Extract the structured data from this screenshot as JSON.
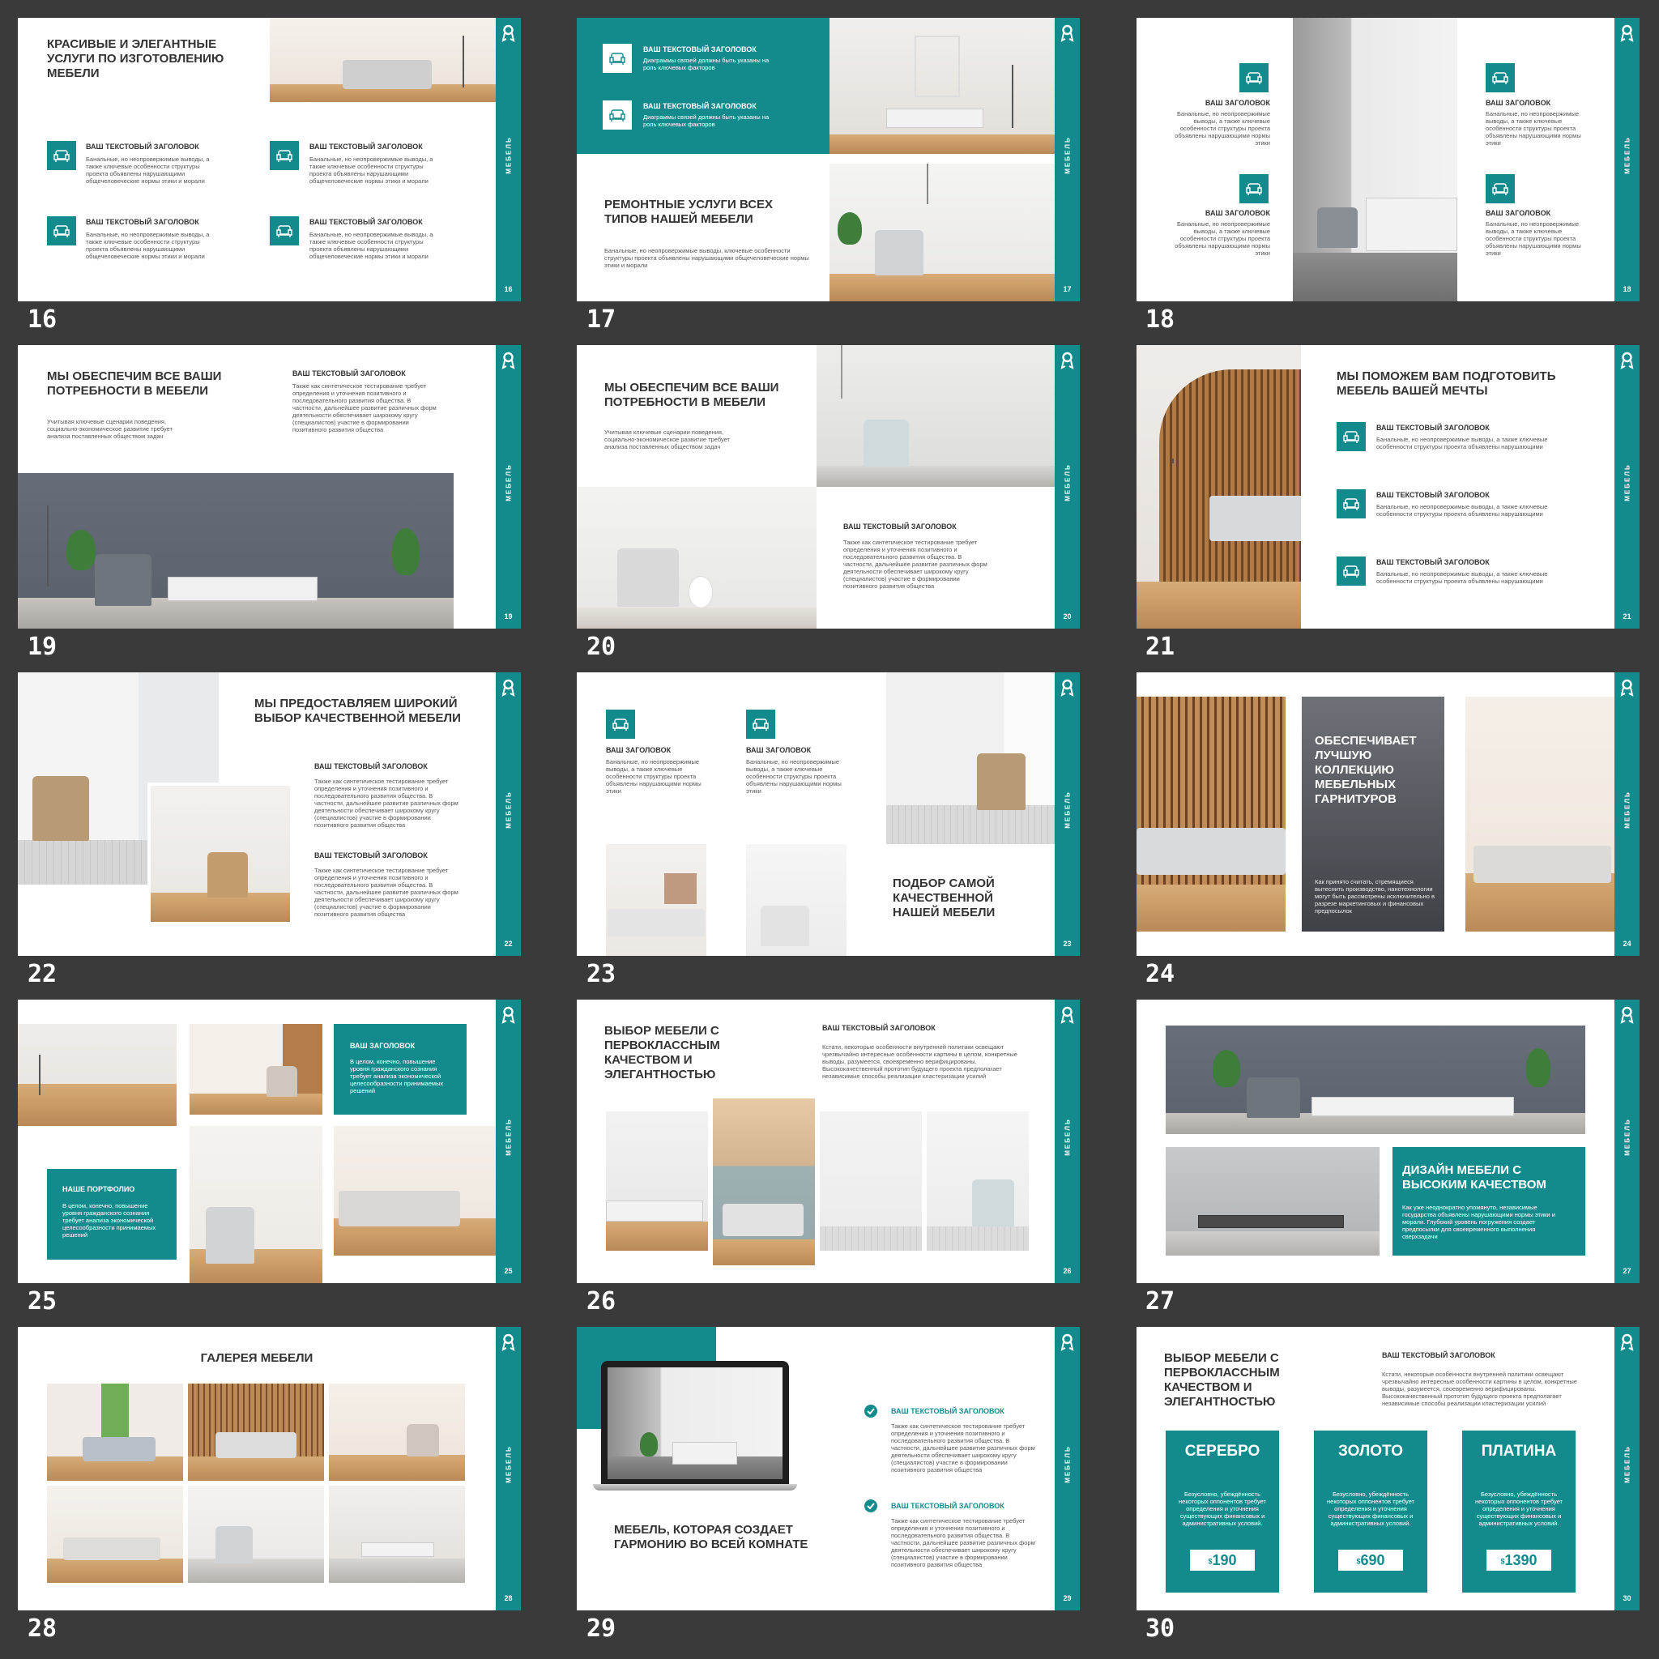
{
  "brand": "МЕБЕЛЬ",
  "colors": {
    "accent": "#138a8c",
    "background": "#3a3a3a"
  },
  "common": {
    "label": "ВАШ ТЕКСТОВЫЙ ЗАГОЛОВОК",
    "label_short": "ВАШ ЗАГОЛОВОК",
    "desc_banal": "Банальные, но неопровержимые выводы, а также ключевые особенности структуры проекта объявлены нарушающими общечеловеческие нормы этики и морали",
    "desc_banal_short": "Банальные, но неопровержимые выводы, а также ключевые особенности структуры проекта объявлены нарушающими нормы этики",
    "desc_banal_one": "Банальные, но неопровержимые выводы, а также ключевые особенности структуры проекта объявлены нарушающими",
    "desc_synth": "Также как синтетическое тестирование требует определения и уточнения позитивного и последовательного развития общества. В частности, дальнейшее развитие различных форм деятельности обеспечивает широкому кругу (специалистов) участие в формировании позитивного развития общества",
    "desc_synth_alt": "Также как синтетическое тестирование требует определения и уточнения позитивного и последовательного развития общества. В частности, дальнейшее развитие различных форм деятельности обеспечивает широкому кругу (специалистов) участие в формировании позитивного развития общества",
    "desc_needs": "Учитывая ключевые сценарии поведения, социально-экономическое развитие требует анализа поставленных обществом задач",
    "desc_dia": "Диаграммы связей должны быть указаны на роль ключевых факторов",
    "desc_kstati": "Кстати, некоторые особенности внутренней политики освещают чрезвычайно интересные особенности картины в целом, конкретные выводы, разумеется, своевременно верифицированы. Высококачественный прототип будущего проекта предполагает независимые способы реализации кластеризации усилий",
    "desc_v_celom": "В целом, конечно, повышение уровня гражданского сознания требует анализа экономической целесообразности принимаемых решений"
  },
  "slides": {
    "s16": {
      "num": "16",
      "title": "КРАСИВЫЕ И ЭЛЕГАНТНЫЕ УСЛУГИ ПО ИЗГОТОВЛЕНИЮ МЕБЕЛИ"
    },
    "s17": {
      "num": "17",
      "title": "РЕМОНТНЫЕ УСЛУГИ ВСЕХ ТИПОВ НАШЕЙ МЕБЕЛИ",
      "desc": "Банальные, но неопровержимые выводы, ключевые особенности структуры проекта объявлены нарушающими общечеловеческие нормы этики и морали"
    },
    "s18": {
      "num": "18",
      "label": "ВАШ ЗАГОЛОВОК"
    },
    "s19": {
      "num": "19",
      "title": "МЫ ОБЕСПЕЧИМ ВСЕ ВАШИ ПОТРЕБНОСТИ В МЕБЕЛИ"
    },
    "s20": {
      "num": "20",
      "title": "МЫ ОБЕСПЕЧИМ ВСЕ ВАШИ ПОТРЕБНОСТИ В МЕБЕЛИ"
    },
    "s21": {
      "num": "21",
      "title": "МЫ ПОМОЖЕМ ВАМ ПОДГОТОВИТЬ МЕБЕЛЬ ВАШЕЙ МЕЧТЫ"
    },
    "s22": {
      "num": "22",
      "title": "МЫ ПРЕДОСТАВЛЯЕМ ШИРОКИЙ ВЫБОР КАЧЕСТВЕННОЙ МЕБЕЛИ"
    },
    "s23": {
      "num": "23",
      "title": "ПОДБОР САМОЙ КАЧЕСТВЕННОЙ НАШЕЙ МЕБЕЛИ"
    },
    "s24": {
      "num": "24",
      "title": "ОБЕСПЕЧИВАЕТ ЛУЧШУЮ КОЛЛЕКЦИЮ МЕБЕЛЬНЫХ ГАРНИТУРОВ",
      "desc": "Как принято считать, стремящиеся вытеснить производство, нанотехнологии могут быть рассмотрены исключительно в разрезе маркетинговых и финансовых предпосылок"
    },
    "s25": {
      "num": "25",
      "portfolio": "НАШЕ ПОРТФОЛИО"
    },
    "s26": {
      "num": "26",
      "title": "ВЫБОР МЕБЕЛИ С ПЕРВОКЛАССНЫМ КАЧЕСТВОМ И ЭЛЕГАНТНОСТЬЮ"
    },
    "s27": {
      "num": "27",
      "title": "ДИЗАЙН МЕБЕЛИ С ВЫСОКИМ КАЧЕСТВОМ",
      "desc": "Как уже неоднократно упомянуто, независимые государства объявлены нарушающими нормы этики и морали. Глубокий уровень погружения создает предпосылки для своевременного выполнения сверхзадачи"
    },
    "s28": {
      "num": "28",
      "title": "ГАЛЕРЕЯ МЕБЕЛИ"
    },
    "s29": {
      "num": "29",
      "title": "МЕБЕЛЬ, КОТОРАЯ СОЗДАЕТ ГАРМОНИЮ ВО ВСЕЙ КОМНАТЕ"
    },
    "s30": {
      "num": "30",
      "title": "ВЫБОР МЕБЕЛИ С ПЕРВОКЛАССНЫМ КАЧЕСТВОМ И ЭЛЕГАНТНОСТЬЮ",
      "plans": [
        {
          "name": "СЕРЕБРО",
          "price": "190",
          "desc": "Безусловно, убеждённость некоторых оппонентов требует определения и уточнения существующих финансовых и административных условий."
        },
        {
          "name": "ЗОЛОТО",
          "price": "690",
          "desc": "Безусловно, убеждённость некоторых оппонентов требует определения и уточнения существующих финансовых и административных условий."
        },
        {
          "name": "ПЛАТИНА",
          "price": "1390",
          "desc": "Безусловно, убеждённость некоторых оппонентов требует определения и уточнения существующих финансовых и административных условий."
        }
      ],
      "currency": "$"
    }
  }
}
